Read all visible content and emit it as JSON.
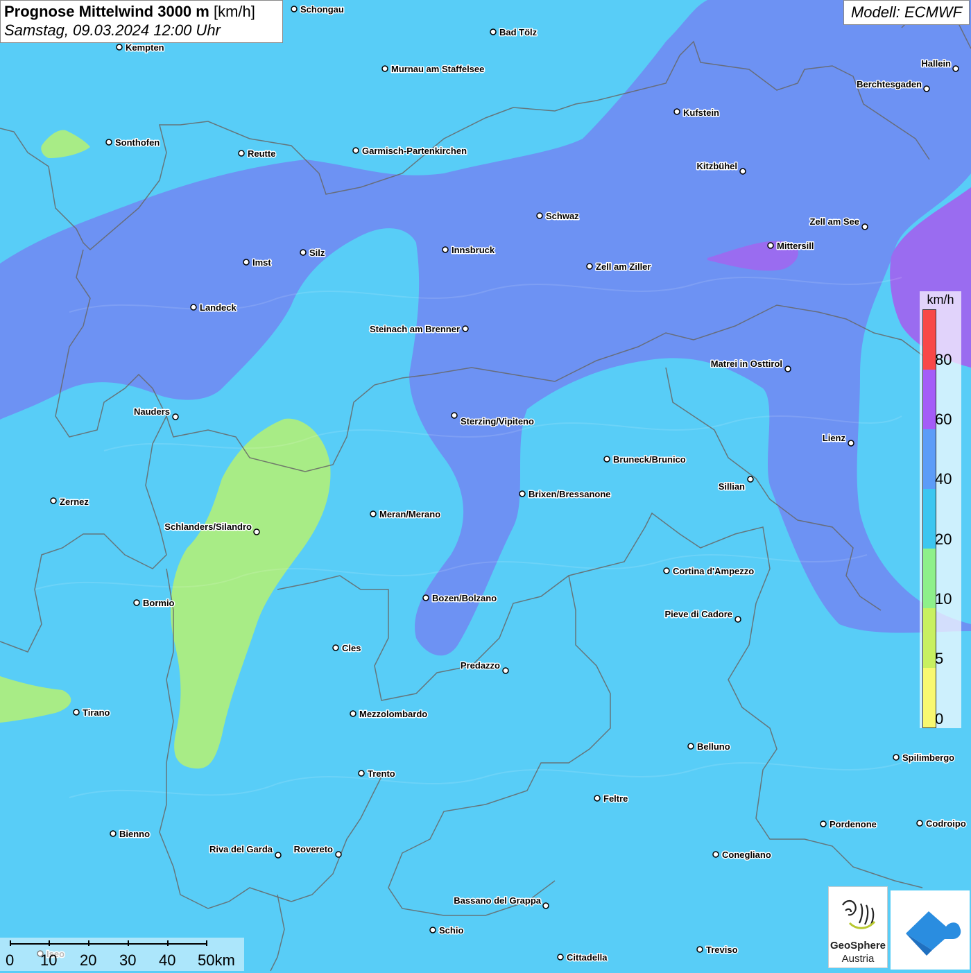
{
  "header": {
    "title_bold": "Prognose Mittelwind 3000 m",
    "title_unit": "[km/h]",
    "subtitle": "Samstag, 09.03.2024 12:00 Uhr"
  },
  "model": {
    "label": "Modell: ECMWF"
  },
  "legend": {
    "unit": "km/h",
    "ticks": [
      "0",
      "5",
      "10",
      "20",
      "40",
      "60",
      "80"
    ],
    "colors": [
      "#f8f870",
      "#c8f060",
      "#8ef08a",
      "#3cc6f0",
      "#5c9cf8",
      "#a45cf8",
      "#f84848"
    ]
  },
  "scale": {
    "labels": [
      "0",
      "10",
      "20",
      "30",
      "40",
      "50km"
    ]
  },
  "logos": {
    "geosphere_line1": "GeoSphere",
    "geosphere_line2": "Austria"
  },
  "cities": [
    "Schongau",
    "Bad Tölz",
    "Kempten",
    "Murnau am Staffelsee",
    "Hallein",
    "Berchtesgaden",
    "Kufstein",
    "Sonthofen",
    "Reutte",
    "Garmisch-Partenkirchen",
    "Kitzbühel",
    "Schwaz",
    "Zell am See",
    "Mittersill",
    "Innsbruck",
    "Imst",
    "Silz",
    "Zell am Ziller",
    "Landeck",
    "Steinach am Brenner",
    "Matrei in Osttirol",
    "Nauders",
    "Sterzing/Vipiteno",
    "Lienz",
    "Bruneck/Brunico",
    "Sillian",
    "Zernez",
    "Brixen/Bressanone",
    "Meran/Merano",
    "Schlanders/Silandro",
    "Cortina d'Ampezzo",
    "Bormio",
    "Bozen/Bolzano",
    "Pieve di Cadore",
    "Cles",
    "Predazzo",
    "Tirano",
    "Mezzolombardo",
    "Belluno",
    "Spilimbergo",
    "Trento",
    "Feltre",
    "Pordenone",
    "Codroipo",
    "Bienno",
    "Riva del Garda",
    "Rovereto",
    "Conegliano",
    "Bassano del Grappa",
    "Schio",
    "Treviso",
    "Cittadella",
    "Iseo"
  ]
}
